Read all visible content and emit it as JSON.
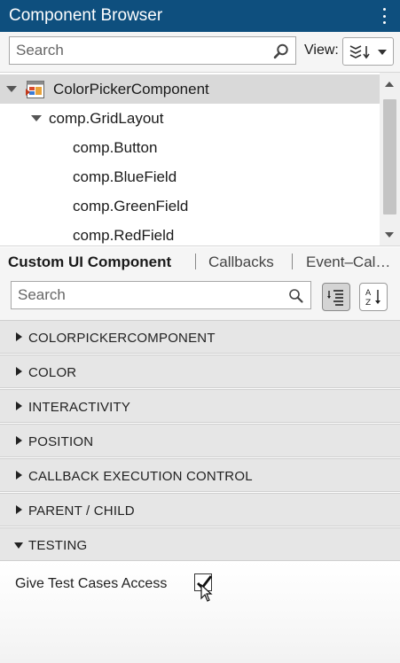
{
  "header": {
    "title": "Component Browser",
    "menu_icon": "kebab-icon"
  },
  "toolbar": {
    "search_placeholder": "Search",
    "view_label": "View:"
  },
  "tree": {
    "items": [
      {
        "label": "ColorPickerComponent",
        "selected": true,
        "expanded": true,
        "icon": "app-component-icon"
      },
      {
        "label": "comp.GridLayout",
        "expanded": true
      },
      {
        "label": "comp.Button"
      },
      {
        "label": "comp.BlueField"
      },
      {
        "label": "comp.GreenField"
      },
      {
        "label": "comp.RedField"
      }
    ]
  },
  "tabs": [
    {
      "label": "Custom UI Component",
      "active": true
    },
    {
      "label": "Callbacks"
    },
    {
      "label": "Event–Cal…"
    }
  ],
  "inspector": {
    "search_placeholder": "Search",
    "sections": [
      {
        "label": "COLORPICKERCOMPONENT",
        "expanded": false
      },
      {
        "label": "COLOR",
        "expanded": false
      },
      {
        "label": "INTERACTIVITY",
        "expanded": false
      },
      {
        "label": "POSITION",
        "expanded": false
      },
      {
        "label": "CALLBACK EXECUTION CONTROL",
        "expanded": false
      },
      {
        "label": "PARENT / CHILD",
        "expanded": false
      },
      {
        "label": "TESTING",
        "expanded": true
      }
    ],
    "testing": {
      "property_label": "Give Test Cases Access",
      "checked": true
    }
  },
  "colors": {
    "titlebar": "#0e4f7e",
    "selected_row": "#d9d9d9",
    "section_bg": "#e6e6e6"
  }
}
